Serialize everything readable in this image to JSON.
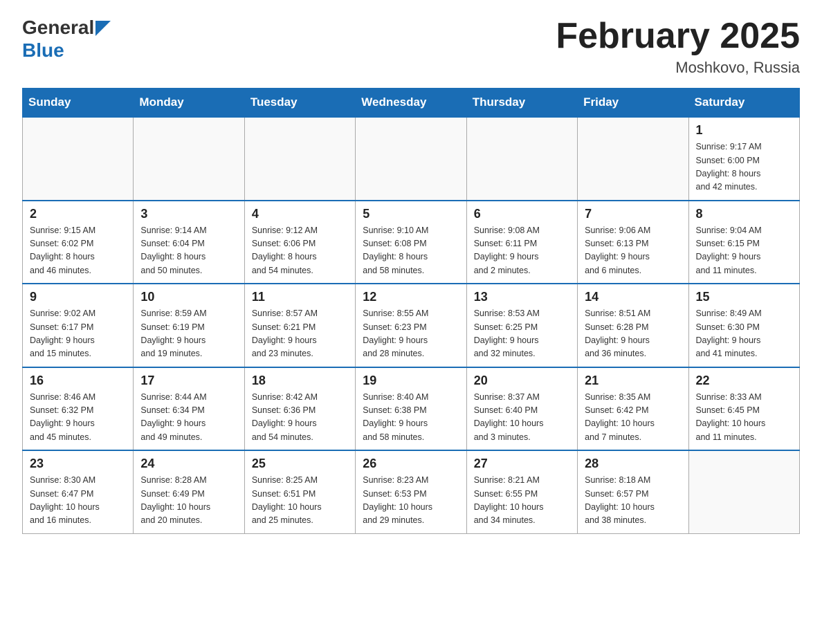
{
  "header": {
    "logo_general": "General",
    "logo_blue": "Blue",
    "month_title": "February 2025",
    "location": "Moshkovo, Russia"
  },
  "weekdays": [
    "Sunday",
    "Monday",
    "Tuesday",
    "Wednesday",
    "Thursday",
    "Friday",
    "Saturday"
  ],
  "weeks": [
    [
      {
        "day": "",
        "info": ""
      },
      {
        "day": "",
        "info": ""
      },
      {
        "day": "",
        "info": ""
      },
      {
        "day": "",
        "info": ""
      },
      {
        "day": "",
        "info": ""
      },
      {
        "day": "",
        "info": ""
      },
      {
        "day": "1",
        "info": "Sunrise: 9:17 AM\nSunset: 6:00 PM\nDaylight: 8 hours\nand 42 minutes."
      }
    ],
    [
      {
        "day": "2",
        "info": "Sunrise: 9:15 AM\nSunset: 6:02 PM\nDaylight: 8 hours\nand 46 minutes."
      },
      {
        "day": "3",
        "info": "Sunrise: 9:14 AM\nSunset: 6:04 PM\nDaylight: 8 hours\nand 50 minutes."
      },
      {
        "day": "4",
        "info": "Sunrise: 9:12 AM\nSunset: 6:06 PM\nDaylight: 8 hours\nand 54 minutes."
      },
      {
        "day": "5",
        "info": "Sunrise: 9:10 AM\nSunset: 6:08 PM\nDaylight: 8 hours\nand 58 minutes."
      },
      {
        "day": "6",
        "info": "Sunrise: 9:08 AM\nSunset: 6:11 PM\nDaylight: 9 hours\nand 2 minutes."
      },
      {
        "day": "7",
        "info": "Sunrise: 9:06 AM\nSunset: 6:13 PM\nDaylight: 9 hours\nand 6 minutes."
      },
      {
        "day": "8",
        "info": "Sunrise: 9:04 AM\nSunset: 6:15 PM\nDaylight: 9 hours\nand 11 minutes."
      }
    ],
    [
      {
        "day": "9",
        "info": "Sunrise: 9:02 AM\nSunset: 6:17 PM\nDaylight: 9 hours\nand 15 minutes."
      },
      {
        "day": "10",
        "info": "Sunrise: 8:59 AM\nSunset: 6:19 PM\nDaylight: 9 hours\nand 19 minutes."
      },
      {
        "day": "11",
        "info": "Sunrise: 8:57 AM\nSunset: 6:21 PM\nDaylight: 9 hours\nand 23 minutes."
      },
      {
        "day": "12",
        "info": "Sunrise: 8:55 AM\nSunset: 6:23 PM\nDaylight: 9 hours\nand 28 minutes."
      },
      {
        "day": "13",
        "info": "Sunrise: 8:53 AM\nSunset: 6:25 PM\nDaylight: 9 hours\nand 32 minutes."
      },
      {
        "day": "14",
        "info": "Sunrise: 8:51 AM\nSunset: 6:28 PM\nDaylight: 9 hours\nand 36 minutes."
      },
      {
        "day": "15",
        "info": "Sunrise: 8:49 AM\nSunset: 6:30 PM\nDaylight: 9 hours\nand 41 minutes."
      }
    ],
    [
      {
        "day": "16",
        "info": "Sunrise: 8:46 AM\nSunset: 6:32 PM\nDaylight: 9 hours\nand 45 minutes."
      },
      {
        "day": "17",
        "info": "Sunrise: 8:44 AM\nSunset: 6:34 PM\nDaylight: 9 hours\nand 49 minutes."
      },
      {
        "day": "18",
        "info": "Sunrise: 8:42 AM\nSunset: 6:36 PM\nDaylight: 9 hours\nand 54 minutes."
      },
      {
        "day": "19",
        "info": "Sunrise: 8:40 AM\nSunset: 6:38 PM\nDaylight: 9 hours\nand 58 minutes."
      },
      {
        "day": "20",
        "info": "Sunrise: 8:37 AM\nSunset: 6:40 PM\nDaylight: 10 hours\nand 3 minutes."
      },
      {
        "day": "21",
        "info": "Sunrise: 8:35 AM\nSunset: 6:42 PM\nDaylight: 10 hours\nand 7 minutes."
      },
      {
        "day": "22",
        "info": "Sunrise: 8:33 AM\nSunset: 6:45 PM\nDaylight: 10 hours\nand 11 minutes."
      }
    ],
    [
      {
        "day": "23",
        "info": "Sunrise: 8:30 AM\nSunset: 6:47 PM\nDaylight: 10 hours\nand 16 minutes."
      },
      {
        "day": "24",
        "info": "Sunrise: 8:28 AM\nSunset: 6:49 PM\nDaylight: 10 hours\nand 20 minutes."
      },
      {
        "day": "25",
        "info": "Sunrise: 8:25 AM\nSunset: 6:51 PM\nDaylight: 10 hours\nand 25 minutes."
      },
      {
        "day": "26",
        "info": "Sunrise: 8:23 AM\nSunset: 6:53 PM\nDaylight: 10 hours\nand 29 minutes."
      },
      {
        "day": "27",
        "info": "Sunrise: 8:21 AM\nSunset: 6:55 PM\nDaylight: 10 hours\nand 34 minutes."
      },
      {
        "day": "28",
        "info": "Sunrise: 8:18 AM\nSunset: 6:57 PM\nDaylight: 10 hours\nand 38 minutes."
      },
      {
        "day": "",
        "info": ""
      }
    ]
  ]
}
